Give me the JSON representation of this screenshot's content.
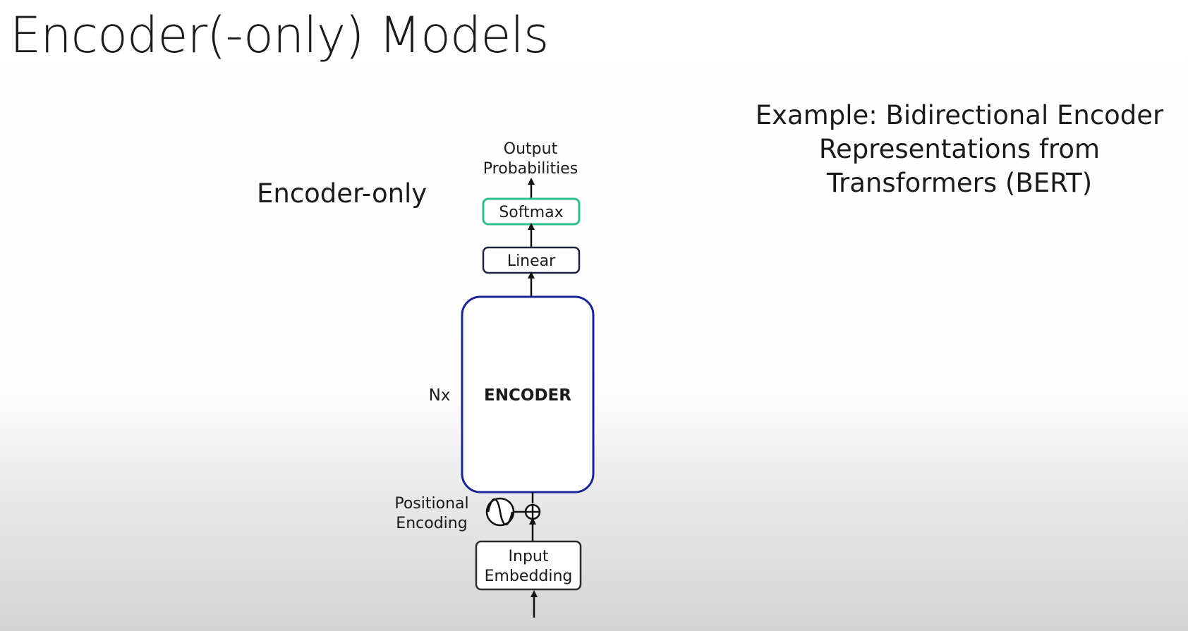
{
  "slide": {
    "title": "Encoder(-only) Models",
    "subtitle": "Encoder-only",
    "example_lines": [
      "Example: Bidirectional Encoder",
      "Representations from",
      "Transformers (BERT)"
    ]
  },
  "diagram": {
    "output_line1": "Output",
    "output_line2": "Probabilities",
    "softmax": "Softmax",
    "linear": "Linear",
    "encoder": "ENCODER",
    "repeat": "Nx",
    "positional_line1": "Positional",
    "positional_line2": "Encoding",
    "input_line1": "Input",
    "input_line2": "Embedding"
  },
  "colors": {
    "softmax_border": "#2fbf8a",
    "encoder_border": "#1a2494",
    "linear_border": "#1d2240",
    "input_border": "#2b2b2b"
  }
}
